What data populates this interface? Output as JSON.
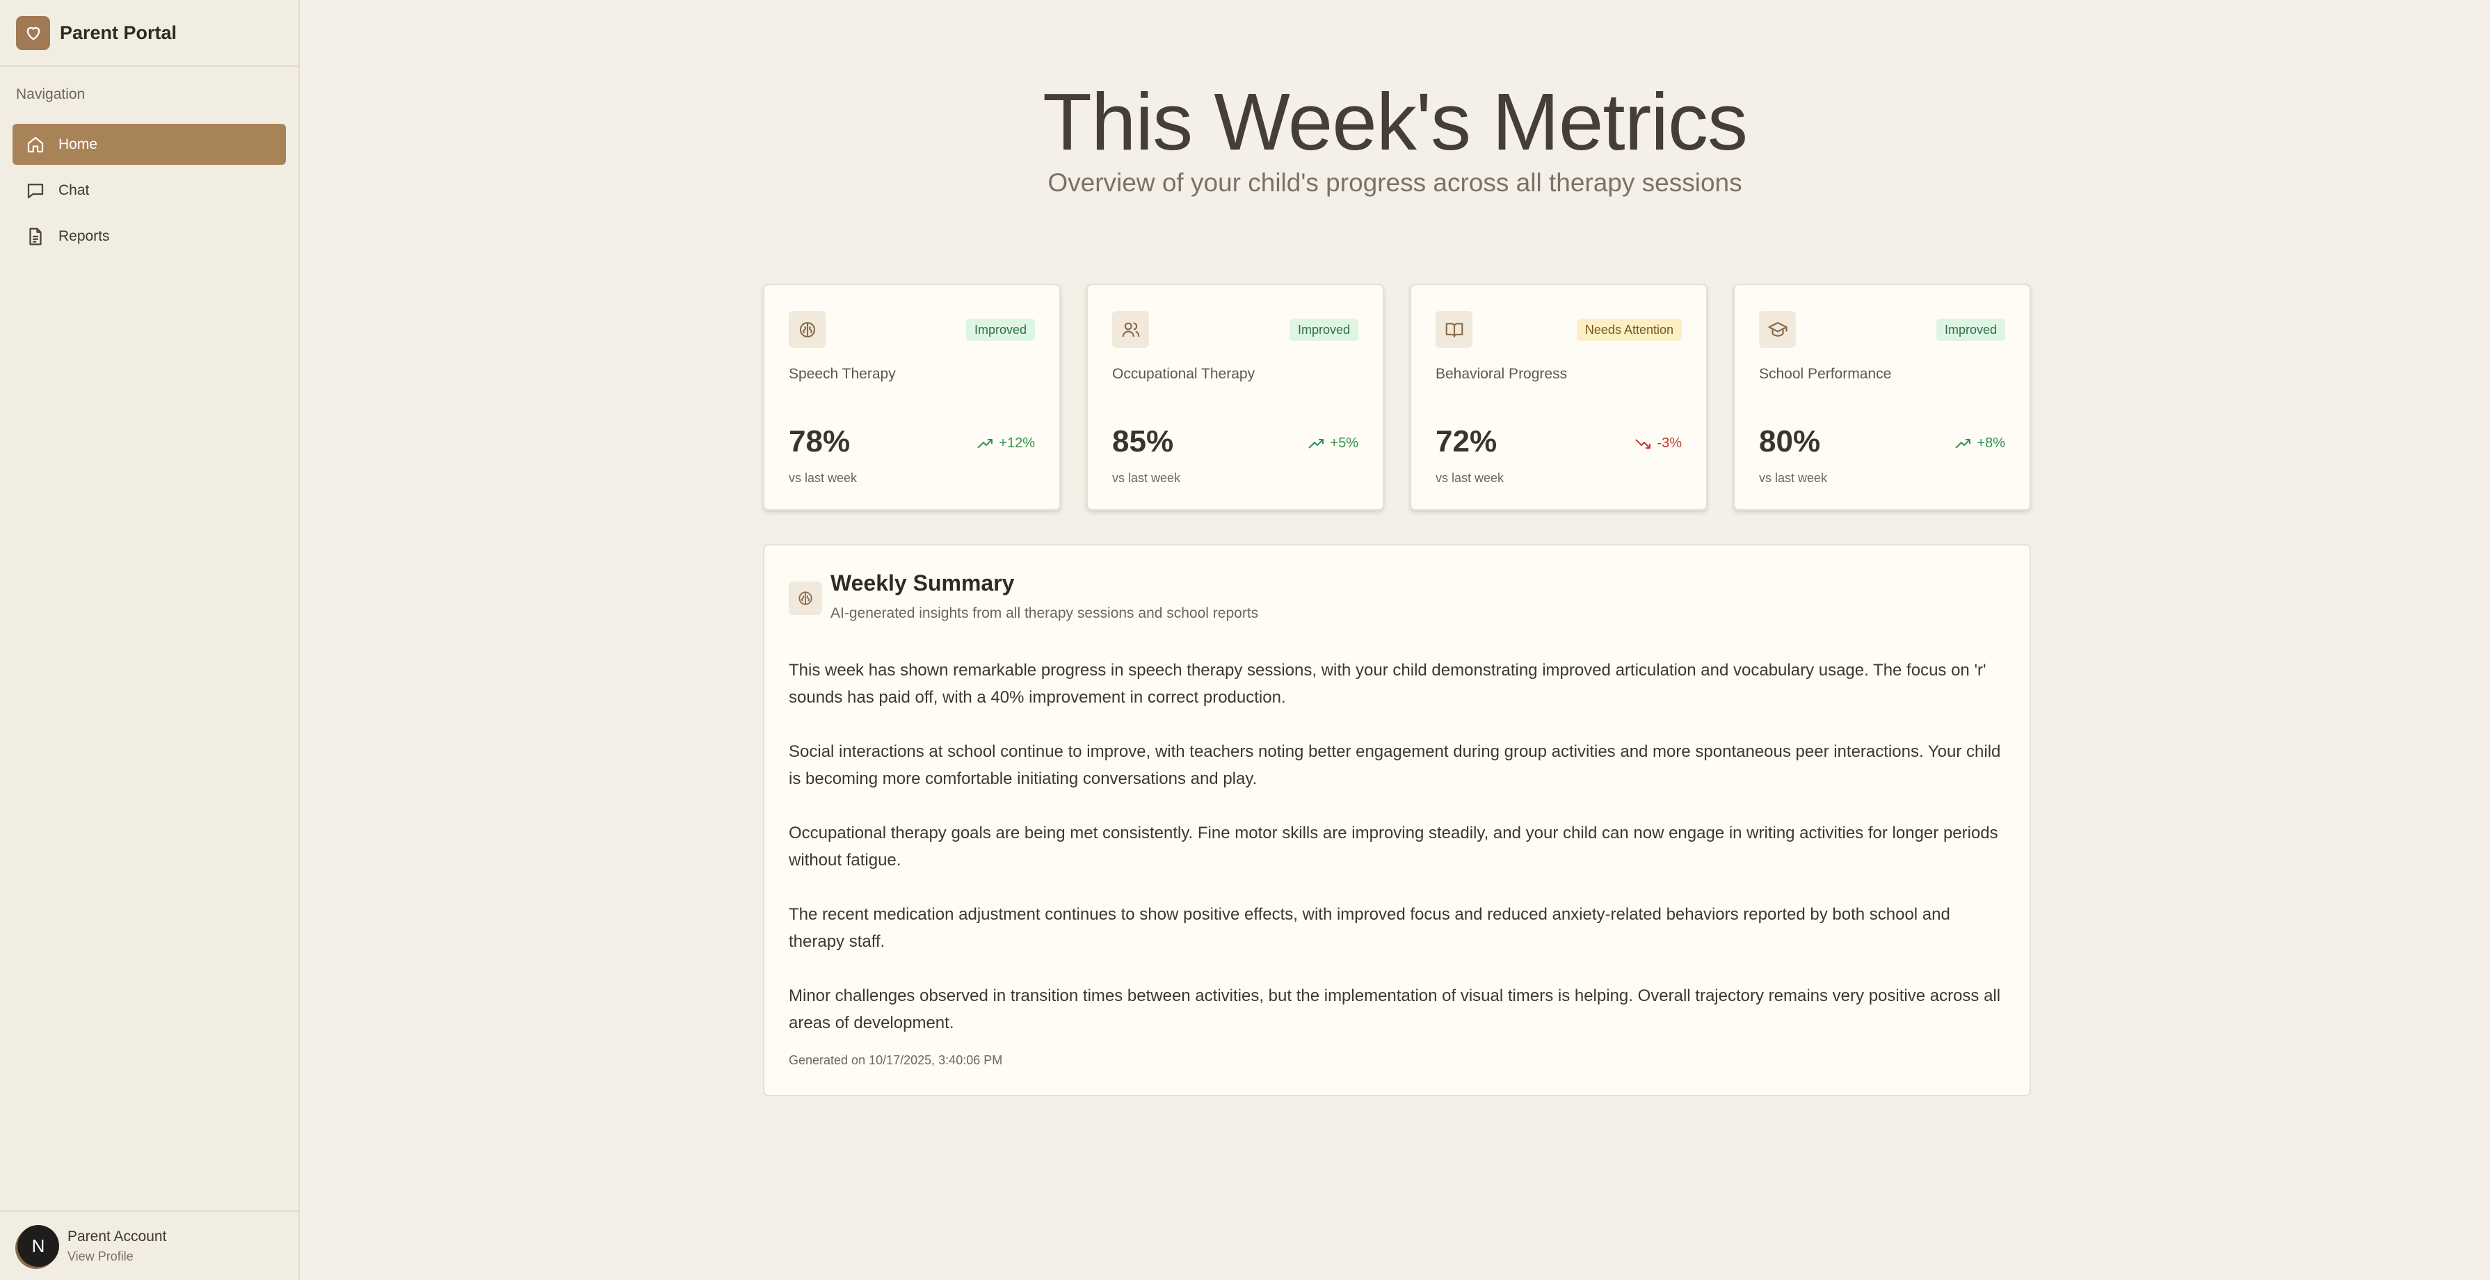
{
  "sidebar": {
    "brand": "Parent Portal",
    "nav_heading": "Navigation",
    "items": [
      {
        "label": "Home",
        "icon": "home-icon",
        "active": true
      },
      {
        "label": "Chat",
        "icon": "chat-icon",
        "active": false
      },
      {
        "label": "Reports",
        "icon": "file-icon",
        "active": false
      }
    ],
    "account": {
      "avatar_letter": "N",
      "name": "Parent Account",
      "link": "View Profile"
    }
  },
  "main": {
    "title": "This Week's Metrics",
    "subtitle": "Overview of your child's progress across all therapy sessions",
    "cards": [
      {
        "name": "Speech Therapy",
        "icon": "brain-icon",
        "badge": "Improved",
        "value": "78%",
        "change": "+12%",
        "trend": "up",
        "foot": "vs last week"
      },
      {
        "name": "Occupational Therapy",
        "icon": "users-icon",
        "badge": "Improved",
        "value": "85%",
        "change": "+5%",
        "trend": "up",
        "foot": "vs last week"
      },
      {
        "name": "Behavioral Progress",
        "icon": "book-icon",
        "badge": "Needs Attention",
        "value": "72%",
        "change": "-3%",
        "trend": "down",
        "foot": "vs last week"
      },
      {
        "name": "School Performance",
        "icon": "graduation-cap-icon",
        "badge": "Improved",
        "value": "80%",
        "change": "+8%",
        "trend": "up",
        "foot": "vs last week"
      }
    ],
    "summary": {
      "title": "Weekly Summary",
      "subtitle": "AI-generated insights from all therapy sessions and school reports",
      "paragraphs": [
        "This week has shown remarkable progress in speech therapy sessions, with your child demonstrating improved articulation and vocabulary usage. The focus on 'r' sounds has paid off, with a 40% improvement in correct production.",
        "Social interactions at school continue to improve, with teachers noting better engagement during group activities and more spontaneous peer interactions. Your child is becoming more comfortable initiating conversations and play.",
        "Occupational therapy goals are being met consistently. Fine motor skills are improving steadily, and your child can now engage in writing activities for longer periods without fatigue.",
        "The recent medication adjustment continues to show positive effects, with improved focus and reduced anxiety-related behaviors reported by both school and therapy staff.",
        "Minor challenges observed in transition times between activities, but the implementation of visual timers is helping. Overall trajectory remains very positive across all areas of development."
      ],
      "generated": "Generated on 10/17/2025, 3:40:06 PM"
    }
  },
  "colors": {
    "accent": "#a98358",
    "background": "#f4f0e8",
    "improved_bg": "#def5e4",
    "attention_bg": "#fcefc4",
    "trend_up": "#34914e",
    "trend_down": "#c0392b"
  }
}
